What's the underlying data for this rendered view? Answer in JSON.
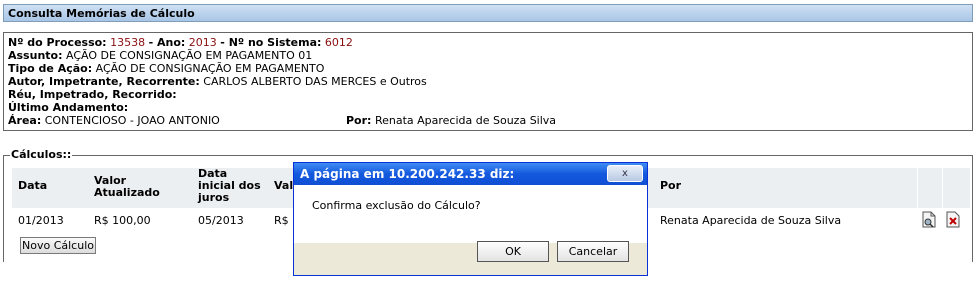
{
  "page_title": "Consulta Memórias de Cálculo",
  "processo": {
    "label_processo": "Nº do Processo:",
    "processo": "13538",
    "label_ano": "Ano:",
    "ano": "2013",
    "label_sistema": "Nº no Sistema:",
    "sistema": "6012",
    "label_assunto": "Assunto:",
    "assunto": "AÇÃO DE CONSIGNAÇÃO EM PAGAMENTO 01",
    "label_tipo": "Tipo de Ação:",
    "tipo": "AÇÃO DE CONSIGNAÇÃO EM PAGAMENTO",
    "label_autor": "Autor, Impetrante, Recorrente:",
    "autor": "CARLOS ALBERTO DAS MERCES e Outros",
    "label_reu": "Réu, Impetrado, Recorrido:",
    "label_andamento": "Último Andamento:",
    "label_area": "Área:",
    "area": "CONTENCIOSO - JOAO ANTONIO",
    "label_por": "Por:",
    "por": "Renata Aparecida de Souza Silva"
  },
  "calculos": {
    "legend": "Cálculos::",
    "headers": {
      "data": "Data",
      "valor1": "Valor",
      "valor2": "Atualizado",
      "datajuros1": "Data",
      "datajuros2": "inicial dos",
      "datajuros3": "juros",
      "val_partial": "Val",
      "por": "Por"
    },
    "row": {
      "data": "01/2013",
      "valor": "R$ 100,00",
      "datajuros": "05/2013",
      "val_partial": "R$",
      "por": "Renata Aparecida de Souza Silva"
    },
    "novo_button": "Novo Cálculo"
  },
  "dialog": {
    "title": "A página em 10.200.242.33 diz:",
    "close": "x",
    "message": "Confirma exclusão do Cálculo?",
    "ok": "OK",
    "cancel": "Cancelar"
  }
}
